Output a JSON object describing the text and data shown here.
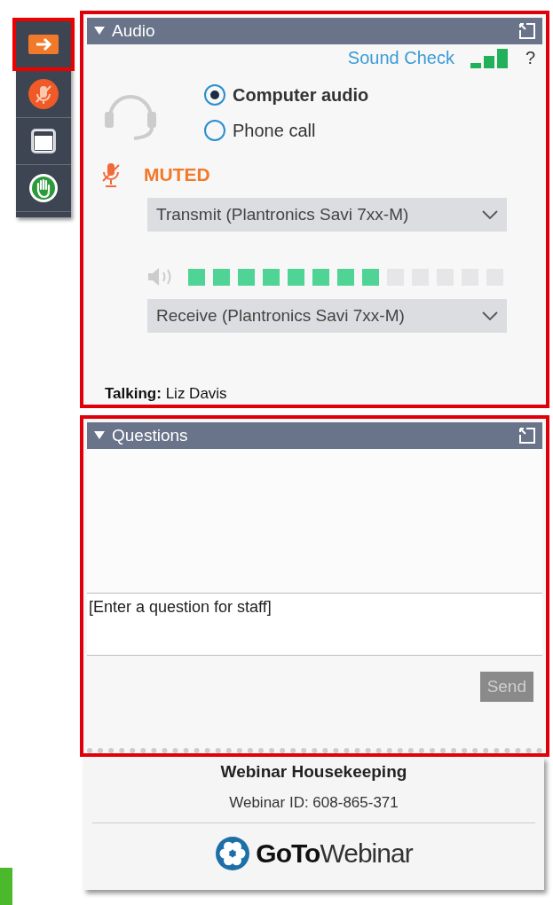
{
  "sidebar": {
    "items": [
      {
        "kind": "arrow",
        "selected": true
      },
      {
        "kind": "mic",
        "selected": false
      },
      {
        "kind": "window",
        "selected": false
      },
      {
        "kind": "hand",
        "selected": false
      }
    ]
  },
  "audio": {
    "title": "Audio",
    "expanded": true,
    "sound_check": "Sound Check",
    "help": "?",
    "options": [
      {
        "label": "Computer audio",
        "selected": true
      },
      {
        "label": "Phone call",
        "selected": false
      }
    ],
    "muted": true,
    "status": "MUTED",
    "transmit": "Transmit (Plantronics Savi 7xx-M)",
    "speaker_meter": {
      "level": 0.615
    },
    "receive": "Receive (Plantronics Savi 7xx-M)",
    "talking_label": "Talking:",
    "talking_name": "Liz Davis"
  },
  "questions": {
    "title": "Questions",
    "expanded": true,
    "placeholder": "[Enter a question for staff]",
    "send": {
      "label": "Send",
      "disabled": true
    }
  },
  "footer": {
    "title": "Webinar Housekeeping",
    "webinar_id": "Webinar ID: 608-865-371",
    "logo": "**GoTo**Webinar"
  }
}
